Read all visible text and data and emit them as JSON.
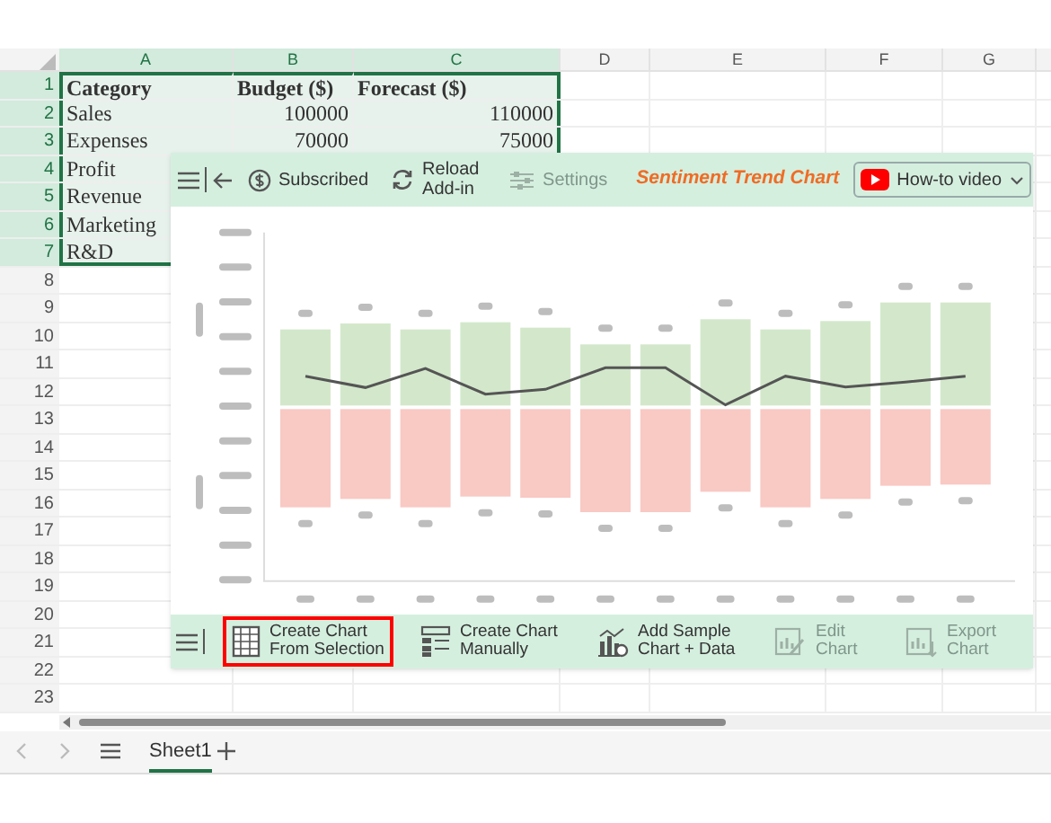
{
  "columns": [
    {
      "label": "A",
      "selected": true
    },
    {
      "label": "B",
      "selected": true
    },
    {
      "label": "C",
      "selected": true
    },
    {
      "label": "D",
      "selected": false
    },
    {
      "label": "E",
      "selected": false
    },
    {
      "label": "F",
      "selected": false
    },
    {
      "label": "G",
      "selected": false
    }
  ],
  "rows": [
    {
      "number": "1",
      "selected": true,
      "cells": [
        {
          "text": "Category",
          "bold": true
        },
        {
          "text": "Budget ($)",
          "bold": true
        },
        {
          "text": "Forecast ($)",
          "bold": true
        }
      ]
    },
    {
      "number": "2",
      "selected": true,
      "cells": [
        {
          "text": "Sales",
          "bold": false
        },
        {
          "text": "100000",
          "bold": false
        },
        {
          "text": "110000",
          "bold": false
        }
      ]
    },
    {
      "number": "3",
      "selected": true,
      "cells": [
        {
          "text": "Expenses",
          "bold": false
        },
        {
          "text": "70000",
          "bold": false
        },
        {
          "text": "75000",
          "bold": false
        }
      ]
    },
    {
      "number": "4",
      "selected": true,
      "cells": [
        {
          "text": "Profit",
          "bold": false
        }
      ]
    },
    {
      "number": "5",
      "selected": true,
      "cells": [
        {
          "text": "Revenue",
          "bold": false
        }
      ]
    },
    {
      "number": "6",
      "selected": true,
      "cells": [
        {
          "text": "Marketing",
          "bold": false
        }
      ]
    },
    {
      "number": "7",
      "selected": true,
      "cells": [
        {
          "text": "R&D",
          "bold": false
        }
      ]
    },
    {
      "number": "8",
      "selected": false,
      "cells": []
    },
    {
      "number": "9",
      "selected": false,
      "cells": []
    },
    {
      "number": "10",
      "selected": false,
      "cells": []
    },
    {
      "number": "11",
      "selected": false,
      "cells": []
    },
    {
      "number": "12",
      "selected": false,
      "cells": []
    },
    {
      "number": "13",
      "selected": false,
      "cells": []
    },
    {
      "number": "14",
      "selected": false,
      "cells": []
    },
    {
      "number": "15",
      "selected": false,
      "cells": []
    },
    {
      "number": "16",
      "selected": false,
      "cells": []
    },
    {
      "number": "17",
      "selected": false,
      "cells": []
    },
    {
      "number": "18",
      "selected": false,
      "cells": []
    },
    {
      "number": "19",
      "selected": false,
      "cells": []
    },
    {
      "number": "20",
      "selected": false,
      "cells": []
    },
    {
      "number": "21",
      "selected": false,
      "cells": []
    },
    {
      "number": "22",
      "selected": false,
      "cells": []
    },
    {
      "number": "23",
      "selected": false,
      "cells": []
    }
  ],
  "addin": {
    "toolbar": [
      {
        "kind": "subscribed",
        "label": "Subscribed",
        "disabled": false
      },
      {
        "kind": "reload",
        "label": "Reload Add-in",
        "disabled": false
      },
      {
        "kind": "settings",
        "label": "Settings",
        "disabled": true
      }
    ],
    "title": "Sentiment Trend Chart",
    "video_dropdown": {
      "label": "How-to video"
    },
    "actions": [
      {
        "kind": "selection",
        "label": "Create Chart From Selection",
        "disabled": false,
        "highlighted": true
      },
      {
        "kind": "manual",
        "label": "Create Chart Manually",
        "disabled": false,
        "highlighted": false
      },
      {
        "kind": "sample",
        "label": "Add Sample Chart + Data",
        "disabled": false,
        "highlighted": false
      },
      {
        "kind": "edit",
        "label": "Edit Chart",
        "disabled": true,
        "highlighted": false
      },
      {
        "kind": "export",
        "label": "Export Chart",
        "disabled": true,
        "highlighted": false
      }
    ]
  },
  "sheet_tabs": [
    {
      "label": "Sheet1",
      "selected": true
    }
  ]
}
